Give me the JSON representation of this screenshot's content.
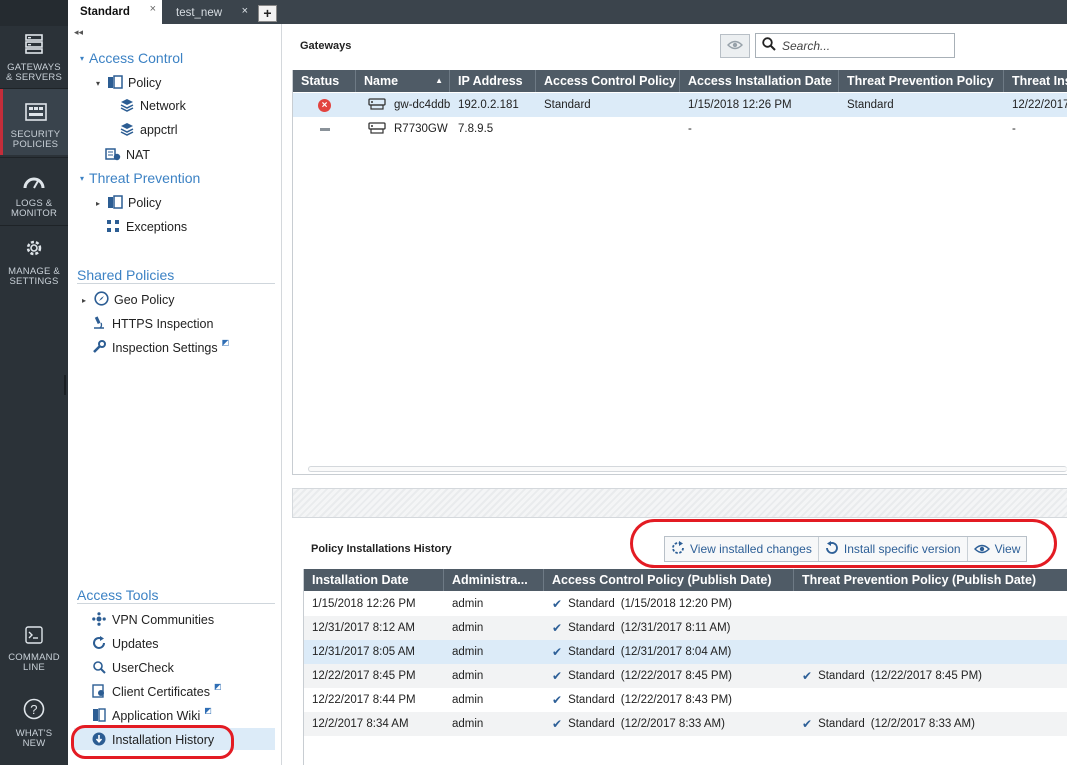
{
  "left_nav": {
    "items": [
      {
        "label_1": "GATEWAYS",
        "label_2": "& SERVERS",
        "icon": "gateways-icon"
      },
      {
        "label_1": "SECURITY",
        "label_2": "POLICIES",
        "icon": "policies-icon"
      },
      {
        "label_1": "LOGS &",
        "label_2": "MONITOR",
        "icon": "gauge-icon"
      },
      {
        "label_1": "MANAGE &",
        "label_2": "SETTINGS",
        "icon": "gear-icon"
      },
      {
        "label_1": "COMMAND",
        "label_2": "LINE",
        "icon": "command-line-icon"
      },
      {
        "label_1": "WHAT'S",
        "label_2": "NEW",
        "icon": "help-icon"
      }
    ],
    "active": "SECURITY POLICIES"
  },
  "tabs": {
    "items": [
      {
        "label": "Standard"
      },
      {
        "label": "test_new"
      }
    ],
    "close_glyph": "×",
    "add_glyph": "+"
  },
  "tree": {
    "collapse_glyph": "◂◂",
    "access_control": {
      "title": "Access Control",
      "policy": "Policy",
      "network": "Network",
      "appctrl": "appctrl",
      "nat": "NAT"
    },
    "threat_prevention": {
      "title": "Threat Prevention",
      "policy": "Policy",
      "exceptions": "Exceptions"
    },
    "shared_policies": {
      "title": "Shared Policies",
      "geo": "Geo Policy",
      "https": "HTTPS Inspection",
      "inspection": "Inspection Settings"
    },
    "access_tools": {
      "title": "Access Tools",
      "vpn": "VPN Communities",
      "updates": "Updates",
      "usercheck": "UserCheck",
      "certs": "Client Certificates",
      "wiki": "Application Wiki",
      "history": "Installation History"
    }
  },
  "gateways": {
    "title": "Gateways",
    "search_placeholder": "Search...",
    "columns": [
      "Status",
      "Name",
      "IP Address",
      "Access Control Policy",
      "Access Installation Date",
      "Threat Prevention Policy",
      "Threat Ins"
    ],
    "rows": [
      {
        "status": "error",
        "name": "gw-dc4ddb",
        "ip": "192.0.2.181",
        "acp": "Standard",
        "date": "1/15/2018 12:26 PM",
        "tpp": "Standard",
        "tdate": "12/22/2017"
      },
      {
        "status": "none",
        "name": "R7730GW",
        "ip": "7.8.9.5",
        "acp": "",
        "date": "-",
        "tpp": "",
        "tdate": "-"
      }
    ]
  },
  "history": {
    "title": "Policy Installations History",
    "actions": {
      "view_changes": "View installed changes",
      "install_version": "Install specific version",
      "view": "View"
    },
    "columns": [
      "Installation Date",
      "Administra...",
      "Access Control Policy (Publish Date)",
      "Threat Prevention Policy (Publish Date)"
    ],
    "rows": [
      {
        "date": "1/15/2018 12:26 PM",
        "admin": "admin",
        "acp": "Standard",
        "acp_date": "(1/15/2018 12:20 PM)",
        "tpp": "",
        "tpp_date": ""
      },
      {
        "date": "12/31/2017 8:12 AM",
        "admin": "admin",
        "acp": "Standard",
        "acp_date": "(12/31/2017 8:11 AM)",
        "tpp": "",
        "tpp_date": ""
      },
      {
        "date": "12/31/2017 8:05 AM",
        "admin": "admin",
        "acp": "Standard",
        "acp_date": "(12/31/2017 8:04 AM)",
        "tpp": "",
        "tpp_date": ""
      },
      {
        "date": "12/22/2017 8:45 PM",
        "admin": "admin",
        "acp": "Standard",
        "acp_date": "(12/22/2017 8:45 PM)",
        "tpp": "Standard",
        "tpp_date": "(12/22/2017 8:45 PM)"
      },
      {
        "date": "12/22/2017 8:44 PM",
        "admin": "admin",
        "acp": "Standard",
        "acp_date": "(12/22/2017 8:43 PM)",
        "tpp": "",
        "tpp_date": ""
      },
      {
        "date": "12/2/2017 8:34 AM",
        "admin": "admin",
        "acp": "Standard",
        "acp_date": "(12/2/2017 8:33 AM)",
        "tpp": "Standard",
        "tpp_date": "(12/2/2017 8:33 AM)"
      }
    ],
    "selected_row": 2
  },
  "colors": {
    "nav_bg": "#2b3238",
    "grid_header": "#4f5b66",
    "accent_blue": "#3c82c4",
    "annotation_red": "#e31b23",
    "selection": "#dcebf8"
  }
}
